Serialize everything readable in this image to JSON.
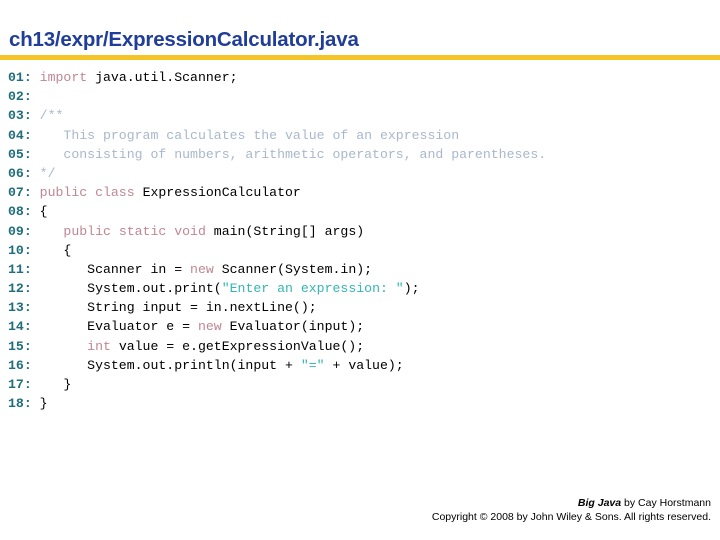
{
  "slide": {
    "title": "ch13/expr/ExpressionCalculator.java",
    "accent_color": "#1F3D99",
    "rule_color": "#F5C426",
    "background_color": "#FFFFFF"
  },
  "syntax_colors": {
    "lineno": "#1F6E7A",
    "plain": "#000000",
    "keyword": "#C08793",
    "comment": "#A8B8CC",
    "string": "#33B6B6"
  },
  "code": {
    "language": "java",
    "lines": [
      {
        "number": "01:",
        "tokens": [
          {
            "t": "keyword",
            "s": "import "
          },
          {
            "t": "plain",
            "s": "java.util.Scanner;"
          }
        ]
      },
      {
        "number": "02:",
        "tokens": []
      },
      {
        "number": "03:",
        "tokens": [
          {
            "t": "comment",
            "s": "/**"
          }
        ]
      },
      {
        "number": "04:",
        "tokens": [
          {
            "t": "comment",
            "s": "   This program calculates the value of an expression"
          }
        ]
      },
      {
        "number": "05:",
        "tokens": [
          {
            "t": "comment",
            "s": "   consisting of numbers, arithmetic operators, and parentheses."
          }
        ]
      },
      {
        "number": "06:",
        "tokens": [
          {
            "t": "comment",
            "s": "*/"
          }
        ]
      },
      {
        "number": "07:",
        "tokens": [
          {
            "t": "keyword",
            "s": "public class "
          },
          {
            "t": "plain",
            "s": "ExpressionCalculator"
          }
        ]
      },
      {
        "number": "08:",
        "tokens": [
          {
            "t": "plain",
            "s": "{"
          }
        ]
      },
      {
        "number": "09:",
        "tokens": [
          {
            "t": "plain",
            "s": "   "
          },
          {
            "t": "keyword",
            "s": "public static void "
          },
          {
            "t": "plain",
            "s": "main(String[] args)"
          }
        ]
      },
      {
        "number": "10:",
        "tokens": [
          {
            "t": "plain",
            "s": "   {"
          }
        ]
      },
      {
        "number": "11:",
        "tokens": [
          {
            "t": "plain",
            "s": "      Scanner in = "
          },
          {
            "t": "keyword",
            "s": "new "
          },
          {
            "t": "plain",
            "s": "Scanner(System.in);"
          }
        ]
      },
      {
        "number": "12:",
        "tokens": [
          {
            "t": "plain",
            "s": "      System.out.print("
          },
          {
            "t": "string",
            "s": "\"Enter an expression: \""
          },
          {
            "t": "plain",
            "s": ");"
          }
        ]
      },
      {
        "number": "13:",
        "tokens": [
          {
            "t": "plain",
            "s": "      String input = in.nextLine();"
          }
        ]
      },
      {
        "number": "14:",
        "tokens": [
          {
            "t": "plain",
            "s": "      Evaluator e = "
          },
          {
            "t": "keyword",
            "s": "new "
          },
          {
            "t": "plain",
            "s": "Evaluator(input);"
          }
        ]
      },
      {
        "number": "15:",
        "tokens": [
          {
            "t": "plain",
            "s": "      "
          },
          {
            "t": "keyword",
            "s": "int "
          },
          {
            "t": "plain",
            "s": "value = e.getExpressionValue();"
          }
        ]
      },
      {
        "number": "16:",
        "tokens": [
          {
            "t": "plain",
            "s": "      System.out.println(input + "
          },
          {
            "t": "string",
            "s": "\"=\""
          },
          {
            "t": "plain",
            "s": " + value);"
          }
        ]
      },
      {
        "number": "17:",
        "tokens": [
          {
            "t": "plain",
            "s": "   }"
          }
        ]
      },
      {
        "number": "18:",
        "tokens": [
          {
            "t": "plain",
            "s": "}"
          }
        ]
      }
    ]
  },
  "footer": {
    "book_title": "Big Java",
    "byline": " by Cay Horstmann",
    "copyright": "Copyright © 2008 by John Wiley & Sons.  All rights reserved."
  }
}
